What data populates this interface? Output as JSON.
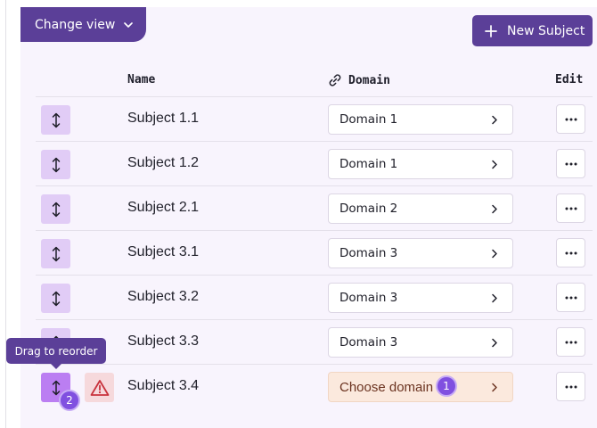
{
  "header": {
    "change_view_label": "Change view",
    "new_subject_label": "New Subject"
  },
  "table": {
    "columns": {
      "name": "Name",
      "domain": "Domain",
      "edit": "Edit"
    },
    "rows": [
      {
        "name": "Subject 1.1",
        "domain": "Domain 1"
      },
      {
        "name": "Subject 1.2",
        "domain": "Domain 1"
      },
      {
        "name": "Subject 2.1",
        "domain": "Domain 2"
      },
      {
        "name": "Subject 3.1",
        "domain": "Domain 3"
      },
      {
        "name": "Subject 3.2",
        "domain": "Domain 3"
      },
      {
        "name": "Subject 3.3",
        "domain": "Domain 3"
      },
      {
        "name": "Subject 3.4",
        "domain": "Choose domain",
        "warning": true
      }
    ]
  },
  "tooltip": {
    "text": "Drag to reorder"
  },
  "badges": {
    "first": "1",
    "second": "2"
  },
  "icons": {
    "change_view": "chevron-down-icon",
    "new_subject": "plus-icon",
    "domain_column": "link-icon",
    "drag": "drag-vertical-icon",
    "domain_chevron": "chevron-right-icon",
    "edit": "more-horizontal-icon",
    "warning": "warning-triangle-icon"
  },
  "colors": {
    "primary": "#5b3f98",
    "panel": "#f8f4fd",
    "drag_handle": "#e1ccf6",
    "drag_handle_active": "#bb7ef2",
    "warning_bg": "#f6d9dc",
    "warning_icon": "#c8323c",
    "choose_domain_bg": "#fbe9dd",
    "badge": "#8050e0"
  }
}
